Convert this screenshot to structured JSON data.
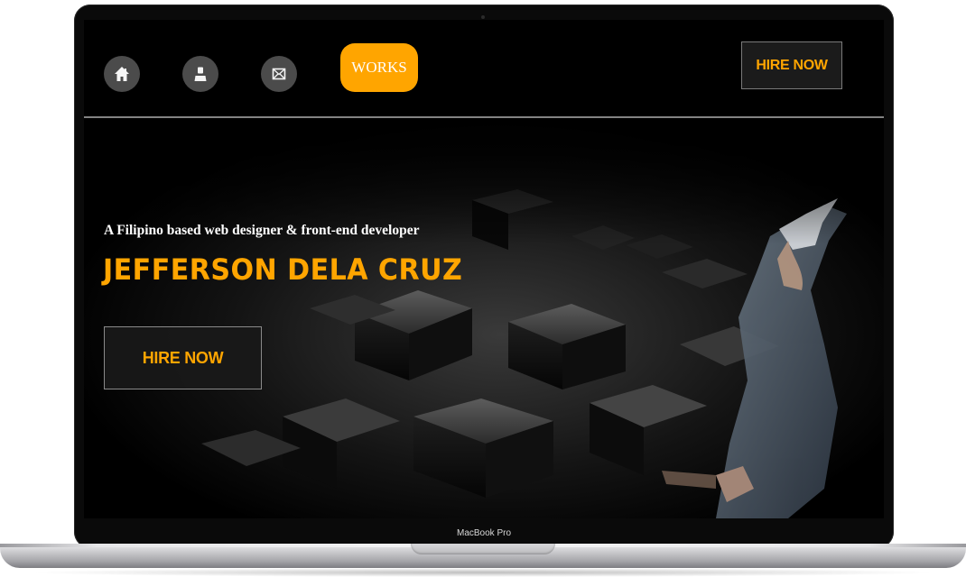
{
  "nav": {
    "icons": [
      {
        "name": "home-icon",
        "glyph": "house"
      },
      {
        "name": "user-icon",
        "glyph": "person"
      },
      {
        "name": "mail-icon",
        "glyph": "envelope"
      }
    ],
    "works_label": "WORKS",
    "hire_label": "HIRE NOW"
  },
  "hero": {
    "subtitle": "A Filipino based web designer & front-end developer",
    "name": "JEFFERSON DELA CRUZ",
    "hire_label": "HIRE NOW"
  },
  "device": {
    "label": "MacBook Pro"
  },
  "colors": {
    "accent": "#ffa500",
    "background": "#000000",
    "icon_bg": "#4b4b4b",
    "text": "#ffffff"
  }
}
